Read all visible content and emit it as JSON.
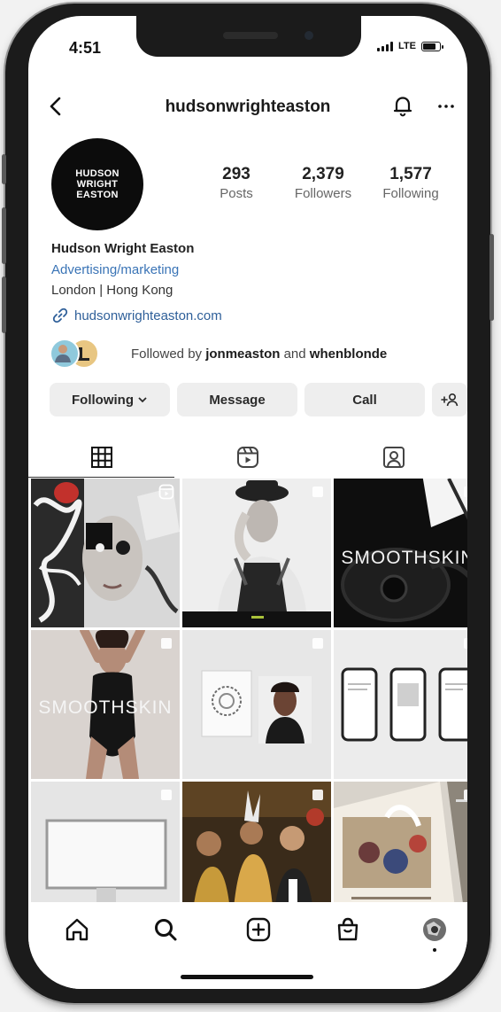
{
  "status": {
    "time": "4:51",
    "network": "LTE",
    "battery_level": 0.8
  },
  "header": {
    "username": "hudsonwrighteaston"
  },
  "profile": {
    "logo_lines": [
      "HUDSON",
      "WRIGHT",
      "EASTON"
    ],
    "stats": [
      {
        "value": "293",
        "label": "Posts"
      },
      {
        "value": "2,379",
        "label": "Followers"
      },
      {
        "value": "1,577",
        "label": "Following"
      }
    ],
    "name": "Hudson Wright Easton",
    "category": "Advertising/marketing",
    "location": "London | Hong Kong",
    "link": "hudsonwrighteaston.com",
    "followed_by": {
      "prefix": "Followed by ",
      "user1": "jonmeaston",
      "joiner": " and ",
      "user2": "whenblonde"
    }
  },
  "actions": {
    "following": "Following",
    "message": "Message",
    "call": "Call"
  },
  "posts": {
    "smoothskin_1": "SMOOTHSKIN",
    "smoothskin_2": "SMOOTHSKIN"
  }
}
